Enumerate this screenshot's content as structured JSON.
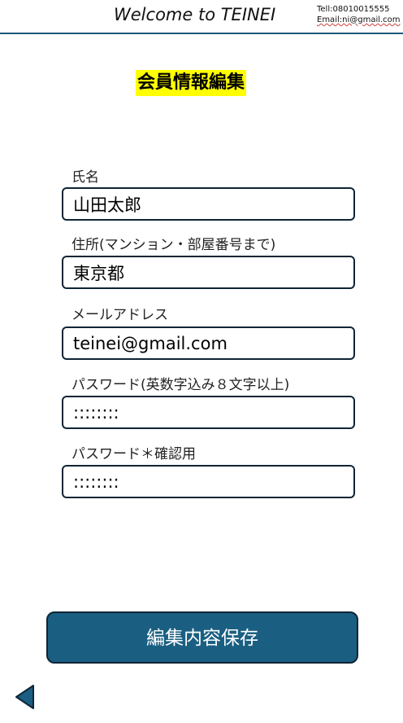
{
  "header": {
    "title": "Welcome to TEINEI",
    "tel": "Tell:08010015555",
    "email": "Email:ni@gmail.com"
  },
  "page_title": "会員情報編集",
  "form": {
    "name": {
      "label": "氏名",
      "value": "山田太郎"
    },
    "address": {
      "label": "住所(マンション・部屋番号まで)",
      "value": "東京都"
    },
    "email": {
      "label": "メールアドレス",
      "value": "teinei@gmail.com"
    },
    "password": {
      "label": "パスワード(英数字込み８文字以上)",
      "value": "::::::::"
    },
    "password_confirm": {
      "label": "パスワード＊確認用",
      "value": "::::::::"
    }
  },
  "submit_label": "編集内容保存",
  "icons": {
    "back": "back-arrow-icon"
  },
  "colors": {
    "accent": "#1a5f82",
    "border": "#0f2535",
    "title_highlight": "#ffff00"
  }
}
